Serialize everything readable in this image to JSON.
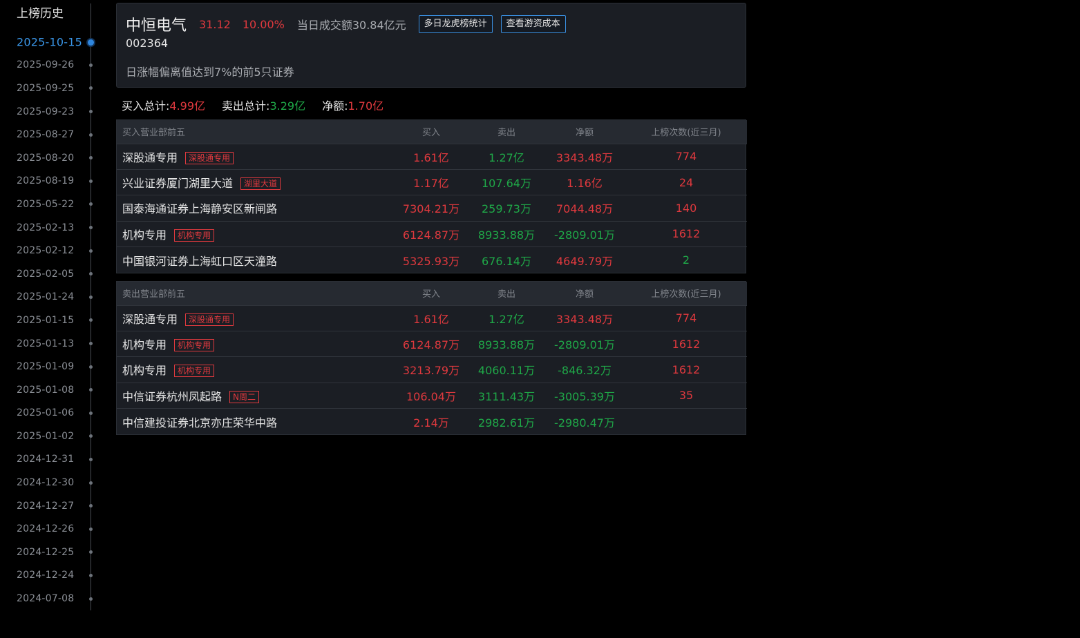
{
  "sidebar": {
    "title": "上榜历史",
    "dates": [
      {
        "label": "2025-10-15",
        "active": true
      },
      {
        "label": "2025-09-26",
        "active": false
      },
      {
        "label": "2025-09-25",
        "active": false
      },
      {
        "label": "2025-09-23",
        "active": false
      },
      {
        "label": "2025-08-27",
        "active": false
      },
      {
        "label": "2025-08-20",
        "active": false
      },
      {
        "label": "2025-08-19",
        "active": false
      },
      {
        "label": "2025-05-22",
        "active": false
      },
      {
        "label": "2025-02-13",
        "active": false
      },
      {
        "label": "2025-02-12",
        "active": false
      },
      {
        "label": "2025-02-05",
        "active": false
      },
      {
        "label": "2025-01-24",
        "active": false
      },
      {
        "label": "2025-01-15",
        "active": false
      },
      {
        "label": "2025-01-13",
        "active": false
      },
      {
        "label": "2025-01-09",
        "active": false
      },
      {
        "label": "2025-01-08",
        "active": false
      },
      {
        "label": "2025-01-06",
        "active": false
      },
      {
        "label": "2025-01-02",
        "active": false
      },
      {
        "label": "2024-12-31",
        "active": false
      },
      {
        "label": "2024-12-30",
        "active": false
      },
      {
        "label": "2024-12-27",
        "active": false
      },
      {
        "label": "2024-12-26",
        "active": false
      },
      {
        "label": "2024-12-25",
        "active": false
      },
      {
        "label": "2024-12-24",
        "active": false
      },
      {
        "label": "2024-07-08",
        "active": false
      }
    ]
  },
  "stock": {
    "name": "中恒电气",
    "price": "31.12",
    "change_pct": "10.00%",
    "turnover": "当日成交额30.84亿元",
    "code": "002364",
    "reason": "日涨幅偏离值达到7%的前5只证券",
    "buttons": {
      "multi_day": "多日龙虎榜统计",
      "cost": "查看游资成本"
    }
  },
  "summary": {
    "buy_label": "买入总计:",
    "buy_value": "4.99亿",
    "sell_label": "卖出总计:",
    "sell_value": "3.29亿",
    "net_label": "净额:",
    "net_value": "1.70亿"
  },
  "buy_table": {
    "headers": [
      "买入营业部前五",
      "买入",
      "卖出",
      "净额",
      "上榜次数(近三月)"
    ],
    "rows": [
      {
        "name": "深股通专用",
        "tag": "深股通专用",
        "buy": "1.61亿",
        "sell": "1.27亿",
        "net": "3343.48万",
        "net_sign": "pos",
        "count": "774",
        "count_color": "red"
      },
      {
        "name": "兴业证券厦门湖里大道",
        "tag": "湖里大道",
        "buy": "1.17亿",
        "sell": "107.64万",
        "net": "1.16亿",
        "net_sign": "pos",
        "count": "24",
        "count_color": "red"
      },
      {
        "name": "国泰海通证券上海静安区新闸路",
        "tag": "",
        "buy": "7304.21万",
        "sell": "259.73万",
        "net": "7044.48万",
        "net_sign": "pos",
        "count": "140",
        "count_color": "red"
      },
      {
        "name": "机构专用",
        "tag": "机构专用",
        "buy": "6124.87万",
        "sell": "8933.88万",
        "net": "-2809.01万",
        "net_sign": "neg",
        "count": "1612",
        "count_color": "red"
      },
      {
        "name": "中国银河证券上海虹口区天潼路",
        "tag": "",
        "buy": "5325.93万",
        "sell": "676.14万",
        "net": "4649.79万",
        "net_sign": "pos",
        "count": "2",
        "count_color": "green"
      }
    ]
  },
  "sell_table": {
    "headers": [
      "卖出营业部前五",
      "买入",
      "卖出",
      "净额",
      "上榜次数(近三月)"
    ],
    "rows": [
      {
        "name": "深股通专用",
        "tag": "深股通专用",
        "buy": "1.61亿",
        "sell": "1.27亿",
        "net": "3343.48万",
        "net_sign": "pos",
        "count": "774",
        "count_color": "red"
      },
      {
        "name": "机构专用",
        "tag": "机构专用",
        "buy": "6124.87万",
        "sell": "8933.88万",
        "net": "-2809.01万",
        "net_sign": "neg",
        "count": "1612",
        "count_color": "red"
      },
      {
        "name": "机构专用",
        "tag": "机构专用",
        "buy": "3213.79万",
        "sell": "4060.11万",
        "net": "-846.32万",
        "net_sign": "neg",
        "count": "1612",
        "count_color": "red"
      },
      {
        "name": "中信证券杭州凤起路",
        "tag": "N周二",
        "buy": "106.04万",
        "sell": "3111.43万",
        "net": "-3005.39万",
        "net_sign": "neg",
        "count": "35",
        "count_color": "red"
      },
      {
        "name": "中信建投证券北京亦庄荣华中路",
        "tag": "",
        "buy": "2.14万",
        "sell": "2982.61万",
        "net": "-2980.47万",
        "net_sign": "neg",
        "count": "",
        "count_color": "red"
      }
    ]
  },
  "colors": {
    "up": "#e0393e",
    "down": "#1fa848",
    "accent": "#3a96e8"
  }
}
